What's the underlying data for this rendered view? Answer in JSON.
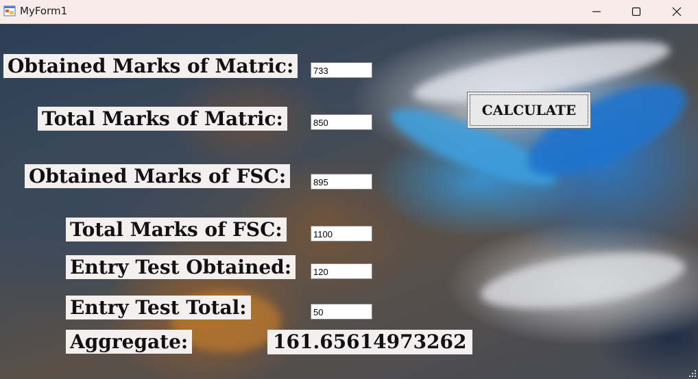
{
  "window": {
    "title": "MyForm1",
    "minimize_icon": "minimize-icon",
    "maximize_icon": "maximize-icon",
    "close_icon": "close-icon"
  },
  "form": {
    "labels": {
      "obtained_matric": "Obtained Marks of Matric:",
      "total_matric": "Total Marks of Matric:",
      "obtained_fsc": "Obtained Marks of FSC:",
      "total_fsc": "Total Marks of FSC:",
      "entry_obtained": "Entry Test Obtained:",
      "entry_total": "Entry Test Total:",
      "aggregate": "Aggregate:"
    },
    "fields": {
      "obtained_matric": "733",
      "total_matric": "850",
      "obtained_fsc": "895",
      "total_fsc": "1100",
      "entry_obtained": "120",
      "entry_total": "50"
    },
    "calculate_label": "CALCULATE",
    "aggregate_value": "161.65614973262"
  },
  "colors": {
    "titlebar": "#f7ecea",
    "label_background": "#f3efef",
    "button_background": "#e9e9e9"
  }
}
